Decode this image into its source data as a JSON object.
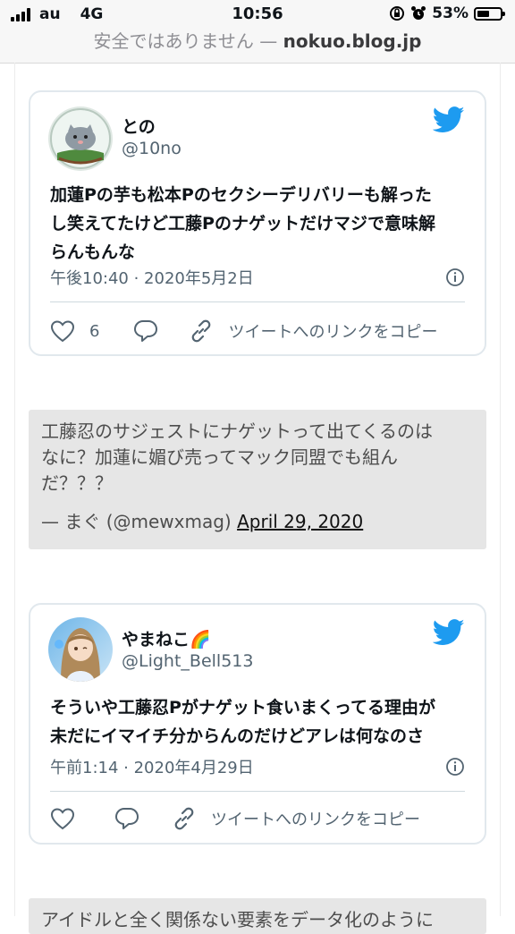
{
  "status_bar": {
    "carrier": "au",
    "network": "4G",
    "time": "10:56",
    "battery": "53%",
    "battery_level": 0.53
  },
  "address_bar": {
    "warning": "安全ではありません —",
    "domain": "nokuo.blog.jp"
  },
  "colors": {
    "twitter_blue": "#1d9bf0",
    "card_border": "#e1e8ed",
    "quote_bg": "#e6e6e6",
    "secondary_text": "#536471"
  },
  "tweets": [
    {
      "name": "との",
      "handle": "@10no",
      "lines": [
        "加蓮Pの芋も松本Pのセクシーデリバリーも解った",
        "し笑えてたけど工藤Pのナゲットだけマジで意味解",
        "らんもんな"
      ],
      "date": "午後10:40 · 2020年5月2日",
      "likes": "6",
      "copy_link": "ツイートへのリンクをコピー"
    },
    {
      "name": "やまねこ🌈",
      "handle": "@Light_Bell513",
      "lines": [
        "そういや工藤忍Pがナゲット食いまくってる理由が",
        "未だにイマイチ分からんのだけどアレは何なのさ"
      ],
      "date": "午前1:14 · 2020年4月29日",
      "likes": "",
      "copy_link": "ツイートへのリンクをコピー"
    }
  ],
  "quotes": [
    {
      "lines": [
        "工藤忍のサジェストにナゲットって出てくるのは",
        "なに？加蓮に媚び売ってマック同盟でも組ん",
        "だ？？？"
      ],
      "author": "— まぐ (@mewxmag)",
      "date": "April 29, 2020"
    },
    {
      "lines": [
        "アイドルと全く関係ない要素をデータ化のように"
      ]
    }
  ]
}
